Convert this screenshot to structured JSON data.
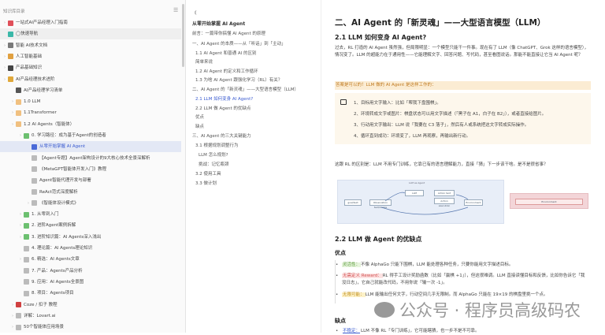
{
  "sidebar": {
    "title": "知识库目录",
    "items": [
      {
        "label": "一站式AI产品经理入门指南",
        "depth": 0,
        "arrow": true,
        "icon": "#e0505a"
      },
      {
        "label": "◯快速导航",
        "depth": 0,
        "arrow": false,
        "icon": "#3bb8a8",
        "hl": true
      },
      {
        "label": "智能 AI技术文档",
        "depth": 0,
        "arrow": true,
        "icon": "#7a7a7a"
      },
      {
        "label": "人工智能基础",
        "depth": 0,
        "arrow": true,
        "icon": "#e0a040"
      },
      {
        "label": "产品基础知识",
        "depth": 0,
        "arrow": true,
        "icon": "#444"
      },
      {
        "label": "AI产品经理技术进阶",
        "depth": 0,
        "arrow": true,
        "icon": "#e0a83a"
      },
      {
        "label": "AI产品经理学习清单",
        "depth": 1,
        "arrow": false,
        "icon": "#555"
      },
      {
        "label": "1.0 LLM",
        "depth": 1,
        "arrow": true,
        "icon": "#f0c080"
      },
      {
        "label": "1.1Transformer",
        "depth": 1,
        "arrow": true,
        "icon": "#f0c080"
      },
      {
        "label": "1.2 AI Agents（智能体）",
        "depth": 1,
        "arrow": true,
        "icon": "#f0c080"
      },
      {
        "label": "0. 学习路径：成为基于Agent的创造者",
        "depth": 2,
        "arrow": true,
        "icon": "#6cc070"
      },
      {
        "label": "从零开始掌握 AI Agent",
        "depth": 3,
        "arrow": false,
        "icon": "#4a6ad8",
        "sel": true
      },
      {
        "label": "【Agent专题】Agent架构设计的9大核心技术全景深解析",
        "depth": 3,
        "arrow": false,
        "icon": "#bbb"
      },
      {
        "label": "《MetaGPT智能体开发入门》教程",
        "depth": 3,
        "arrow": false,
        "icon": "#bbb"
      },
      {
        "label": "Agent智能代理开发与部署",
        "depth": 3,
        "arrow": false,
        "icon": "#bbb"
      },
      {
        "label": "ReAct范式深度解析",
        "depth": 3,
        "arrow": false,
        "icon": "#bbb"
      },
      {
        "label": "《智能体设计模式》",
        "depth": 3,
        "arrow": true,
        "icon": "#bbb"
      },
      {
        "label": "1. 从零到入门",
        "depth": 2,
        "arrow": true,
        "icon": "#6cc070"
      },
      {
        "label": "2. 进阶Agent案例拆解",
        "depth": 2,
        "arrow": true,
        "icon": "#6cc070"
      },
      {
        "label": "3. 进阶知识篇：AI Agents深入浅出",
        "depth": 2,
        "arrow": true,
        "icon": "#6cc070"
      },
      {
        "label": "4. 理论篇：AI Agents理论知识",
        "depth": 2,
        "arrow": false,
        "icon": "#bbb"
      },
      {
        "label": "6. 精选：AI Agents文章",
        "depth": 2,
        "arrow": true,
        "icon": "#bbb"
      },
      {
        "label": "7. 产品：Agents产品分析",
        "depth": 2,
        "arrow": false,
        "icon": "#bbb"
      },
      {
        "label": "9. 应用：AI Agents全景图",
        "depth": 2,
        "arrow": false,
        "icon": "#bbb"
      },
      {
        "label": "8. 项目：Agents项目",
        "depth": 2,
        "arrow": false,
        "icon": "#bbb"
      },
      {
        "label": "Coze / 扣子 教程",
        "depth": 1,
        "arrow": true,
        "icon": "#d04040"
      },
      {
        "label": "详解：Lovart.ai",
        "depth": 1,
        "arrow": true,
        "icon": "#bbb"
      },
      {
        "label": "50个智能体应用场景",
        "depth": 1,
        "arrow": true,
        "icon": "#bbb"
      }
    ]
  },
  "outline": {
    "collapse": "《",
    "items": [
      {
        "label": "从零开始掌握 AI Agent",
        "level": 0
      },
      {
        "label": "前言：一篇带你搞懂 AI Agent 的原理",
        "level": 1
      },
      {
        "label": "一、AI Agent 的本质——从「听话」到「主动」",
        "level": 1
      },
      {
        "label": "1.1 AI Agent 和普通 AI 的区别",
        "level": 2
      },
      {
        "label": "简单来说",
        "level": 2
      },
      {
        "label": "1.2 AI Agent 的定义和工作循环",
        "level": 2
      },
      {
        "label": "1.3 为啥 AI Agent 跟强化学习（RL）有关？",
        "level": 2
      },
      {
        "label": "二、AI Agent 的「新灵魂」——大型语言模型（LLM）",
        "level": 1
      },
      {
        "label": "2.1 LLM 如何变身 AI Agent?",
        "level": 2,
        "active": true
      },
      {
        "label": "2.2 LLM 做 Agent 的优缺点",
        "level": 2
      },
      {
        "label": "优点",
        "level": 2
      },
      {
        "label": "缺点",
        "level": 2
      },
      {
        "label": "三、AI Agent 的三大关键能力",
        "level": 1
      },
      {
        "label": "3.1 根据规划调整行为",
        "level": 2
      },
      {
        "label": "LLM 怎么规划?",
        "level": 3
      },
      {
        "label": "挑战：记忆瓶颈",
        "level": 3
      },
      {
        "label": "3.2 使用工具",
        "level": 2
      },
      {
        "label": "3.3 做计划",
        "level": 2
      }
    ]
  },
  "main": {
    "h2": "二、AI Agent 的「新灵魂」——大型语言模型（LLM）",
    "h3_1": "2.1 LLM 如何变身 AI Agent?",
    "p1": "过去，RL 打造的 AI Agent 虽然强，但局限明显：一个模型只能干一件事。现在有了 LLM（像 ChatGPT、Grok 这样的语言模型），情况变了。LLM 的超能力在于通用性——它能理解文字、回答问题、写代码，甚至看图说话。那能不能直接让它当 AI Agent 呢？",
    "highlight": "答案是可以的！LLM 做的 AI Agent 是这样工作的：",
    "steps": [
      "1、目标用文字输入：比如「帮我下盘围棋」。",
      "2、环境转成文字或图片：棋盘状态可以用文字描述（「黑子在 A1，白子在 B2」），或者直接给图片。",
      "3、行动用文字输出：LLM 说「我要在 C3 落子」，然后有人或系统把这文字转成实际操作。",
      "4、循环直到成功：环境变了，LLM 再观察，再输出新行动。"
    ],
    "p2": "这跟 RL 的区别是：LLM 不用专门训练，它靠已有的语言理解能力，直接「猜」下一步该干啥。是不是很省事？",
    "diagram": {
      "title": "LLM as Agent",
      "nodes": [
        "goal/text",
        "Observation text/image",
        "LLM",
        "Action text",
        "Action execution",
        "Environment"
      ],
      "side": "Environment"
    },
    "h3_2": "2.2 LLM 做 Agent 的优缺点",
    "pros_title": "优点",
    "pros": [
      {
        "tag": "灵活性：",
        "tag_color": "#e6f4dc",
        "text": "不像 AlphaGo 只能下围棋，LLM 能处理各种任务，只要你能用文字描述目标。"
      },
      {
        "tag": "无需定义 Reward：",
        "tag_color": "#fde2e2",
        "text": "RL 得手工设计奖励函数（比如「赢棋 +1」），但这很难调。LLM 直接读懂目标和反馈，比如你告诉它「我没日志」，它自己就能改代码，不用你说「输一次 -1」。"
      },
      {
        "tag": "无限可能：",
        "tag_color": "#fdf1c8",
        "text": "LLM 能输出任何文字，行动空间几乎无限制。而 AlphaGo 只能在 19×19 的棋盘里挑一个点。"
      }
    ],
    "cons_title": "缺点",
    "cons": [
      {
        "tag": "不稳定：",
        "text": "LLM 不像 RL「专门训练」，它可能瞎猜，也一步不是不可靠。"
      }
    ]
  },
  "watermark": "公众号 · 程序员高级码农"
}
